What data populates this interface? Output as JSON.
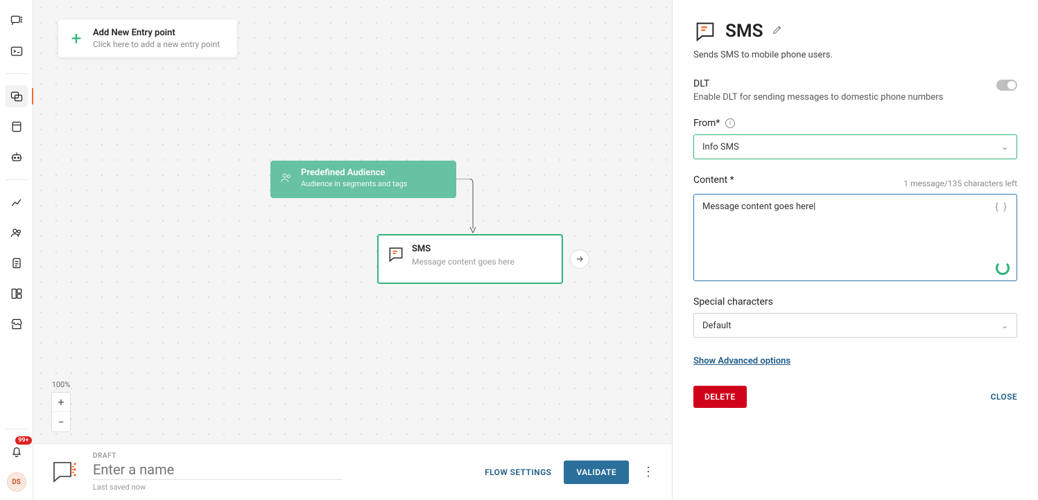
{
  "rail": {
    "notification_badge": "99+",
    "avatar_initials": "DS"
  },
  "entry": {
    "title": "Add New Entry point",
    "sub": "Click here to add a new entry point"
  },
  "audience": {
    "title": "Predefined Audience",
    "sub": "Audience in segments and tags"
  },
  "sms_node": {
    "title": "SMS",
    "sub": "Message content goes here"
  },
  "zoom": {
    "label": "100%"
  },
  "bottom": {
    "status": "DRAFT",
    "name_placeholder": "Enter a name",
    "saved": "Last saved now",
    "flow_settings": "FLOW SETTINGS",
    "validate": "VALIDATE"
  },
  "panel": {
    "title": "SMS",
    "desc": "Sends SMS to mobile phone users.",
    "dlt": {
      "label": "DLT",
      "sub": "Enable DLT for sending messages to domestic phone numbers"
    },
    "from": {
      "label": "From*",
      "value": "Info SMS"
    },
    "content": {
      "label": "Content *",
      "counter": "1 message/135 characters left",
      "value": "Message content goes here"
    },
    "special": {
      "label": "Special characters",
      "value": "Default"
    },
    "advanced": "Show Advanced options",
    "delete": "DELETE",
    "close": "CLOSE"
  }
}
